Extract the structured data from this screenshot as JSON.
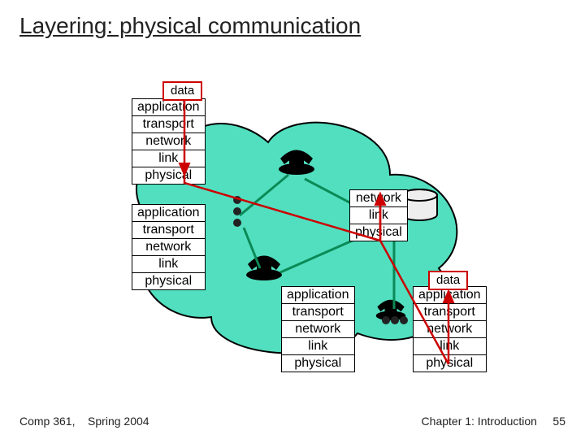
{
  "title": "Layering: physical communication",
  "data_label": "data",
  "stack5": [
    "application",
    "transport",
    "network",
    "link",
    "physical"
  ],
  "stack3": [
    "network",
    "link",
    "physical"
  ],
  "footer_left_course": "Comp 361,",
  "footer_left_term": "Spring 2004",
  "footer_right_chapter": "Chapter 1: Introduction",
  "footer_right_page": "55"
}
